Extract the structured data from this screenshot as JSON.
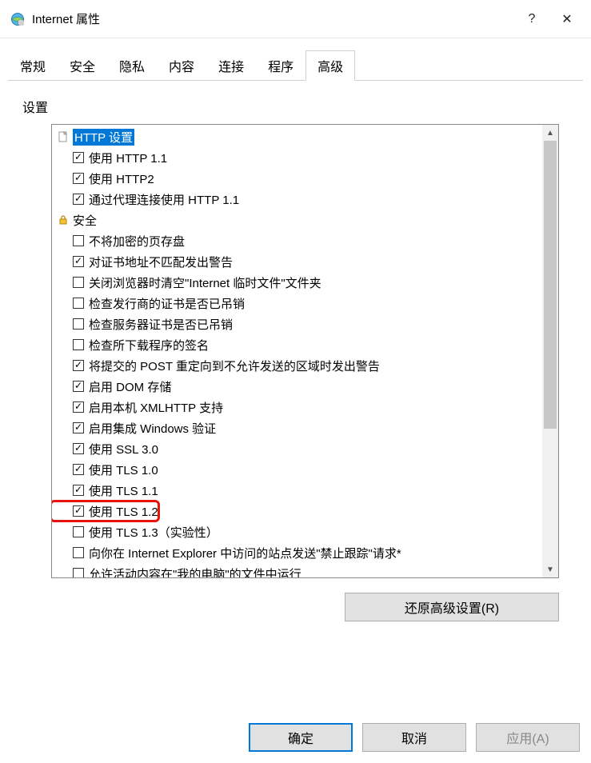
{
  "title": "Internet 属性",
  "help_glyph": "?",
  "close_glyph": "✕",
  "tabs": [
    "常规",
    "安全",
    "隐私",
    "内容",
    "连接",
    "程序",
    "高级"
  ],
  "active_tab_index": 6,
  "group_label": "设置",
  "categories": [
    {
      "label": "HTTP 设置",
      "icon": "page",
      "selected": true,
      "items": [
        {
          "label": "使用 HTTP 1.1",
          "checked": true
        },
        {
          "label": "使用 HTTP2",
          "checked": true
        },
        {
          "label": "通过代理连接使用 HTTP 1.1",
          "checked": true
        }
      ]
    },
    {
      "label": "安全",
      "icon": "lock",
      "selected": false,
      "items": [
        {
          "label": "不将加密的页存盘",
          "checked": false
        },
        {
          "label": "对证书地址不匹配发出警告",
          "checked": true
        },
        {
          "label": "关闭浏览器时清空\"Internet 临时文件\"文件夹",
          "checked": false
        },
        {
          "label": "检查发行商的证书是否已吊销",
          "checked": false
        },
        {
          "label": "检查服务器证书是否已吊销",
          "checked": false
        },
        {
          "label": "检查所下载程序的签名",
          "checked": false
        },
        {
          "label": "将提交的 POST 重定向到不允许发送的区域时发出警告",
          "checked": true
        },
        {
          "label": "启用 DOM 存储",
          "checked": true
        },
        {
          "label": "启用本机 XMLHTTP 支持",
          "checked": true
        },
        {
          "label": "启用集成 Windows 验证",
          "checked": true
        },
        {
          "label": "使用 SSL 3.0",
          "checked": true
        },
        {
          "label": "使用 TLS 1.0",
          "checked": true
        },
        {
          "label": "使用 TLS 1.1",
          "checked": true
        },
        {
          "label": "使用 TLS 1.2",
          "checked": true,
          "highlighted": true
        },
        {
          "label": "使用 TLS 1.3（实验性）",
          "checked": false
        },
        {
          "label": "向你在 Internet Explorer 中访问的站点发送\"禁止跟踪\"请求*",
          "checked": false
        },
        {
          "label": "允许活动内容在\"我的电脑\"的文件中运行",
          "checked": false
        }
      ]
    }
  ],
  "restore_label": "还原高级设置(R)",
  "buttons": {
    "ok": "确定",
    "cancel": "取消",
    "apply": "应用(A)"
  },
  "scroll": {
    "up_glyph": "▲",
    "down_glyph": "▼"
  }
}
